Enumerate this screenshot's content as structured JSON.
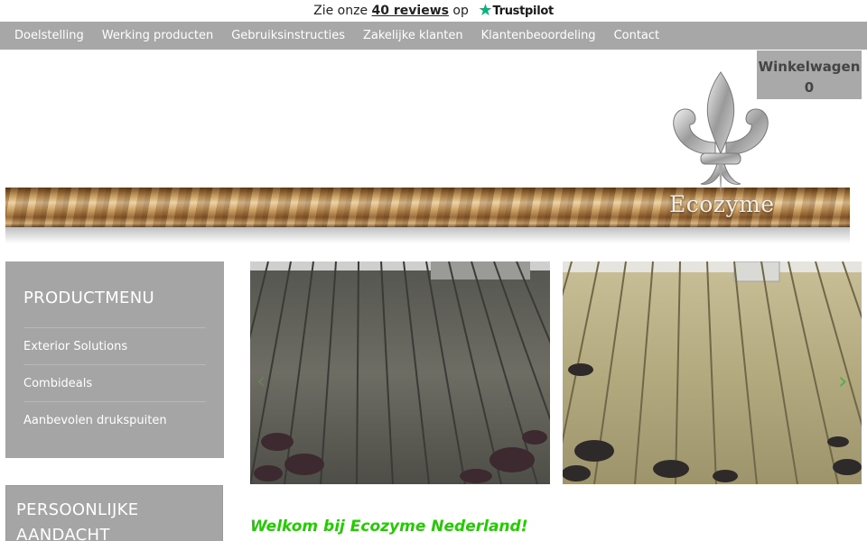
{
  "trustbar": {
    "prefix": "Zie onze",
    "reviews_link": "40 reviews",
    "suffix": "op",
    "brand": "Trustpilot",
    "brand_icon": "star-icon",
    "brand_color": "#00b67a"
  },
  "nav": {
    "items": [
      {
        "label": "Doelstelling"
      },
      {
        "label": "Werking producten"
      },
      {
        "label": "Gebruiksinstructies"
      },
      {
        "label": "Zakelijke klanten"
      },
      {
        "label": "Klantenbeoordeling"
      },
      {
        "label": "Contact"
      }
    ]
  },
  "cart": {
    "label": "Winkelwagen",
    "count": "0"
  },
  "logo": {
    "text": "Ecozyme",
    "icon": "fleur-de-lis-icon"
  },
  "productmenu": {
    "title": "PRODUCTMENU",
    "items": [
      {
        "label": "Exterior Solutions"
      },
      {
        "label": "Combideals"
      },
      {
        "label": "Aanbevolen drukspuiten"
      }
    ]
  },
  "personal": {
    "title": "PERSOONLIJKE AANDACHT"
  },
  "slider": {
    "prev_icon": "chevron-left-icon",
    "next_icon": "chevron-right-icon"
  },
  "welcome": {
    "heading": "Welkom bij Ecozyme Nederland!",
    "color": "#22cc00"
  },
  "colors": {
    "nav_bg": "#a7a7a7",
    "menu_bg": "#a5a5a5"
  }
}
